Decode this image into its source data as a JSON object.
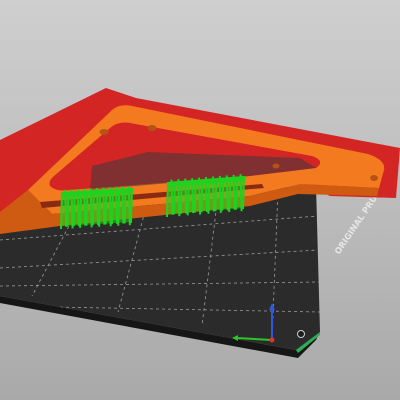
{
  "view": {
    "background_top": "#cfcfcf",
    "background_bottom": "#a9a9a9"
  },
  "bed": {
    "label": "ORIGINAL PRUSA MI",
    "surface_color": "#2b2b2b",
    "grid_color": "#9a9a9a"
  },
  "model": {
    "body_color": "#f47a20",
    "body_shadow_color": "#cf5a12",
    "overhang_color": "#d42525",
    "support_color": "#1fd21f",
    "support_blocks": 2
  },
  "axes": {
    "x_color": "#2cc62c",
    "y_color": "#2f56e0",
    "z_color": "#e02f2f"
  }
}
